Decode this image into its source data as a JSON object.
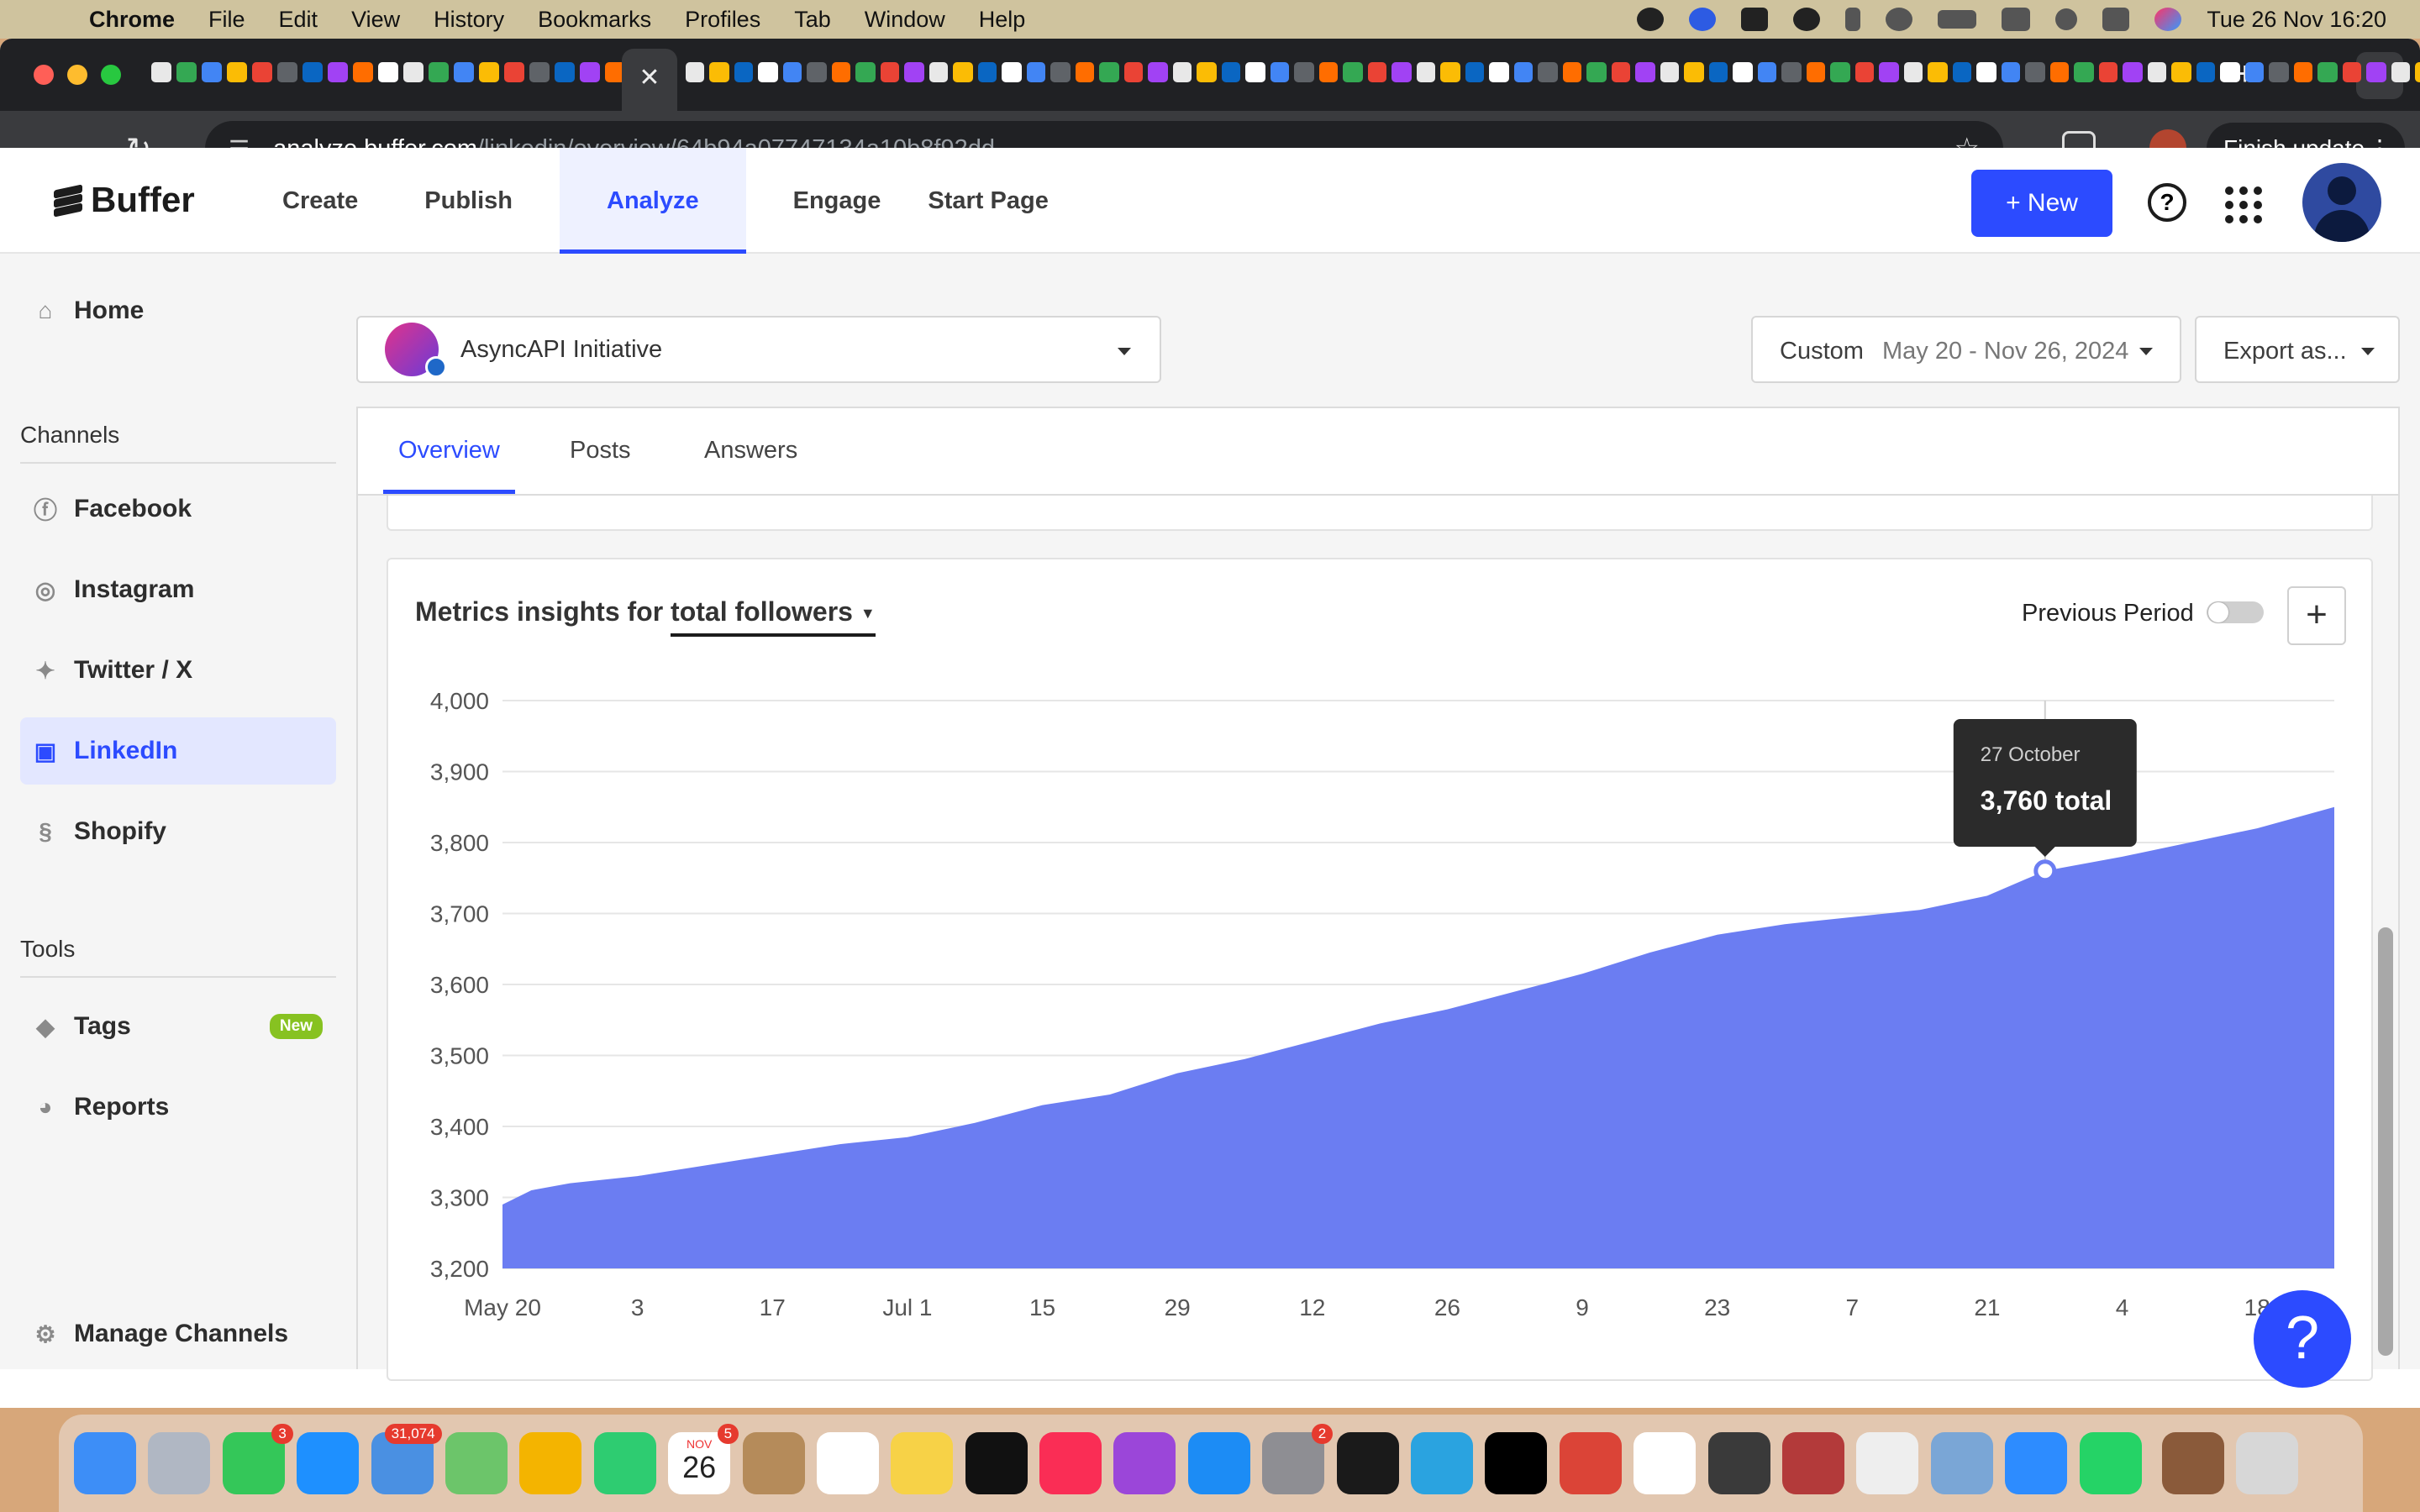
{
  "menubar": {
    "app": "Chrome",
    "items": [
      "File",
      "Edit",
      "View",
      "History",
      "Bookmarks",
      "Profiles",
      "Tab",
      "Window",
      "Help"
    ],
    "datetime": "Tue 26 Nov  16:20"
  },
  "browser": {
    "url_host": "analyze.buffer.com",
    "url_path": "/linkedin/overview/64b94a07747134a10b8f92dd",
    "finish_update": "Finish update",
    "close_tab_glyph": "✕",
    "new_tab_glyph": "+"
  },
  "nav": {
    "logo": "Buffer",
    "links": [
      "Create",
      "Publish",
      "Analyze",
      "Engage",
      "Start Page"
    ],
    "active": "Analyze",
    "new_button": "+  New",
    "help_glyph": "?"
  },
  "sidebar": {
    "home": "Home",
    "channels_heading": "Channels",
    "channels": [
      "Facebook",
      "Instagram",
      "Twitter / X",
      "LinkedIn",
      "Shopify"
    ],
    "active_channel": "LinkedIn",
    "tools_heading": "Tools",
    "tags": "Tags",
    "tags_badge": "New",
    "reports": "Reports",
    "manage": "Manage Channels"
  },
  "account": {
    "name": "AsyncAPI Initiative"
  },
  "date_range": {
    "preset": "Custom",
    "range": "May 20 - Nov 26, 2024"
  },
  "export_label": "Export as...",
  "tabs": [
    "Overview",
    "Posts",
    "Answers"
  ],
  "active_tab": "Overview",
  "metrics_card": {
    "title_prefix": "Metrics insights for",
    "metric": "total followers",
    "previous_period_label": "Previous Period",
    "add_glyph": "+"
  },
  "tooltip": {
    "date": "27 October",
    "value": "3,760 total"
  },
  "colors": {
    "accent": "#2c4bff",
    "area": "#6b7df2",
    "tooltip_bg": "#2b2b2b"
  },
  "chart_data": {
    "type": "area",
    "title": "",
    "xlabel": "",
    "ylabel": "",
    "ylim": [
      3200,
      4000
    ],
    "y_ticks": [
      "4,000",
      "3,900",
      "3,800",
      "3,700",
      "3,600",
      "3,500",
      "3,400",
      "3,300",
      "3,200"
    ],
    "x_tick_labels": [
      "May 20",
      "3",
      "17",
      "Jul 1",
      "15",
      "29",
      "12",
      "26",
      "9",
      "23",
      "7",
      "21",
      "4",
      "18"
    ],
    "grid": true,
    "series": [
      {
        "x": [
          "2024-05-20",
          "2024-05-23",
          "2024-05-27",
          "2024-06-03",
          "2024-06-10",
          "2024-06-17",
          "2024-06-24",
          "2024-07-01",
          "2024-07-08",
          "2024-07-15",
          "2024-07-22",
          "2024-07-29",
          "2024-08-05",
          "2024-08-12",
          "2024-08-19",
          "2024-08-26",
          "2024-09-02",
          "2024-09-09",
          "2024-09-16",
          "2024-09-23",
          "2024-09-30",
          "2024-10-07",
          "2024-10-14",
          "2024-10-21",
          "2024-10-27",
          "2024-11-04",
          "2024-11-11",
          "2024-11-18",
          "2024-11-26"
        ],
        "y": [
          3290,
          3310,
          3320,
          3330,
          3345,
          3360,
          3375,
          3385,
          3405,
          3430,
          3445,
          3475,
          3495,
          3520,
          3545,
          3565,
          3590,
          3615,
          3645,
          3670,
          3685,
          3695,
          3705,
          3725,
          3760,
          3780,
          3800,
          3820,
          3850
        ]
      }
    ],
    "highlight": {
      "x": "2024-10-27",
      "y": 3760
    }
  },
  "dock_badges": {
    "messages": "3",
    "mail": "31,074",
    "calendar_month": "NOV",
    "calendar_day": "26",
    "calendar_badge": "5",
    "settings_badge": "2"
  }
}
